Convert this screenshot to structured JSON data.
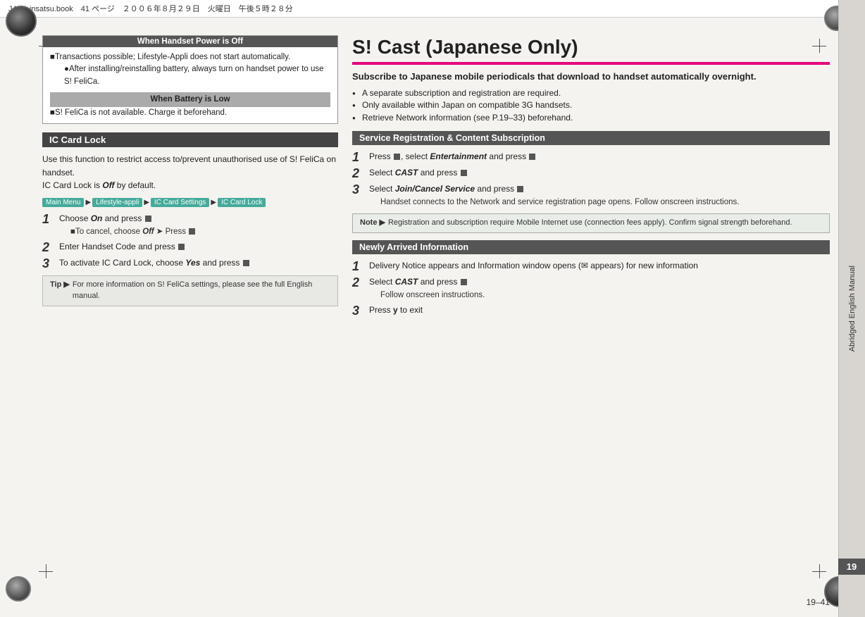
{
  "header": {
    "text": "J410_insatsu.book　41 ページ　２００６年８月２９日　火曜日　午後５時２８分"
  },
  "sidebar": {
    "label": "Abridged English Manual",
    "page_tab": "19"
  },
  "page_number_bottom": "19–41",
  "left": {
    "handset_power_box": {
      "header": "When Handset Power is Off",
      "line1": "■Transactions possible; Lifestyle-Appli does not start automatically.",
      "line2": "●After installing/reinstalling battery, always turn on handset power to use S! FeliCa.",
      "battery_header": "When Battery is Low",
      "battery_line": "■S! FeliCa is not available. Charge it beforehand."
    },
    "ic_card_lock": {
      "title": "IC Card Lock",
      "body1": "Use this function to restrict access to/prevent unauthorised use of S! FeliCa on handset.",
      "body2": "IC Card Lock is ",
      "body2_italic": "Off",
      "body2_end": " by default.",
      "breadcrumbs": [
        "Main Menu",
        "Lifestyle-appli",
        "IC Card Settings",
        "IC Card Lock"
      ],
      "steps": [
        {
          "num": "1",
          "text": "Choose ",
          "italic": "On",
          "text2": " and press ",
          "sub": "■To cancel, choose Off ➤ Press ■"
        },
        {
          "num": "2",
          "text": "Enter Handset Code and press ■"
        },
        {
          "num": "3",
          "text": "To activate IC Card Lock, choose ",
          "italic": "Yes",
          "text2": " and press ■"
        }
      ],
      "tip": {
        "label": "Tip ▶",
        "text": "For more information on S! FeliCa settings, please see the full English manual."
      }
    }
  },
  "right": {
    "title": "S! Cast (Japanese Only)",
    "intro": "Subscribe to Japanese mobile periodicals that download to handset automatically overnight.",
    "bullets": [
      "A separate subscription and registration are required.",
      "Only available within Japan on compatible 3G handsets.",
      "Retrieve Network information (see P.19–33) beforehand."
    ],
    "service_section": {
      "header": "Service Registration & Content Subscription",
      "steps": [
        {
          "num": "1",
          "text": "Press ■, select ",
          "italic": "Entertainment",
          "text2": " and press ■"
        },
        {
          "num": "2",
          "text": "Select ",
          "italic": "CAST",
          "text2": " and press ■"
        },
        {
          "num": "3",
          "text": "Select ",
          "italic": "Join/Cancel Service",
          "text2": " and press ■",
          "sub": "Handset connects to the Network and service registration page opens. Follow onscreen instructions."
        }
      ],
      "note": {
        "label": "Note ▶",
        "text": "Registration and subscription require Mobile Internet use (connection fees apply). Confirm signal strength beforehand."
      }
    },
    "newly_arrived": {
      "header": "Newly Arrived Information",
      "steps": [
        {
          "num": "1",
          "text": "Delivery Notice appears and Information window opens (🖂 appears) for new information"
        },
        {
          "num": "2",
          "text": "Select ",
          "italic": "CAST",
          "text2": " and press ■",
          "sub": "Follow onscreen instructions."
        },
        {
          "num": "3",
          "text": "Press ",
          "key": "y",
          "text2": " to exit"
        }
      ]
    }
  }
}
